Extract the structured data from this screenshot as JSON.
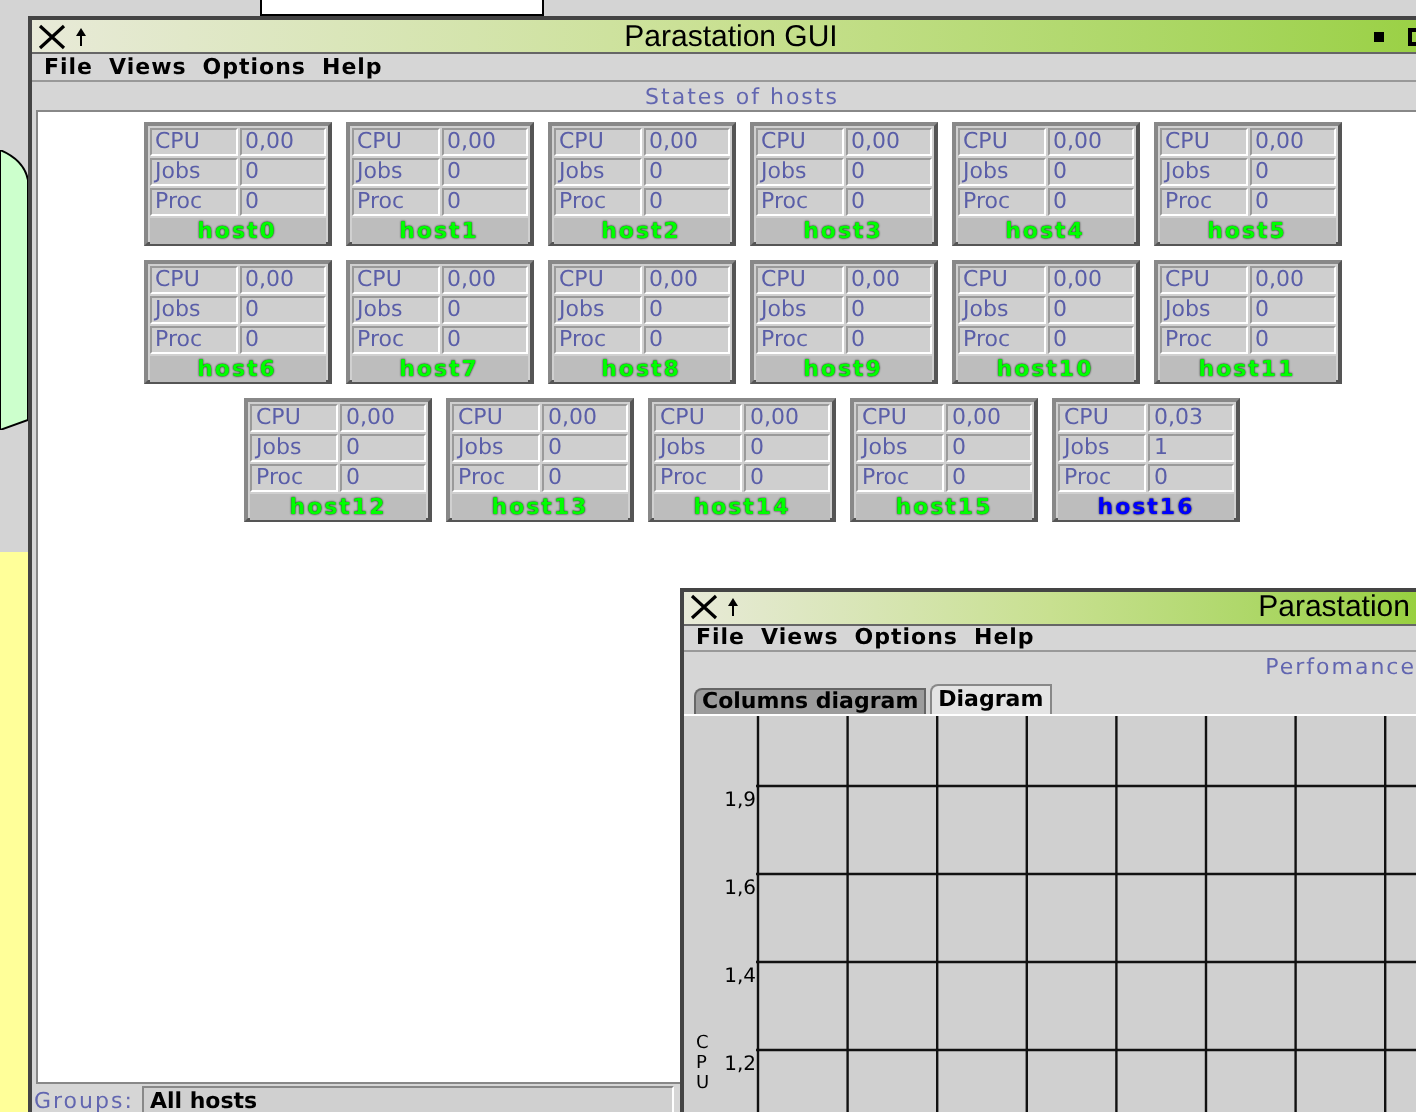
{
  "main_window": {
    "title": "Parastation GUI",
    "menu": [
      "File",
      "Views",
      "Options",
      "Help"
    ],
    "panel_title": "States of hosts",
    "hosts": [
      {
        "name": "host0",
        "color": "#00ff00",
        "rows": [
          {
            "label": "CPU",
            "value": "0,00"
          },
          {
            "label": "Jobs",
            "value": "0"
          },
          {
            "label": "Proc",
            "value": "0"
          }
        ]
      },
      {
        "name": "host1",
        "color": "#00ff00",
        "rows": [
          {
            "label": "CPU",
            "value": "0,00"
          },
          {
            "label": "Jobs",
            "value": "0"
          },
          {
            "label": "Proc",
            "value": "0"
          }
        ]
      },
      {
        "name": "host2",
        "color": "#00ff00",
        "rows": [
          {
            "label": "CPU",
            "value": "0,00"
          },
          {
            "label": "Jobs",
            "value": "0"
          },
          {
            "label": "Proc",
            "value": "0"
          }
        ]
      },
      {
        "name": "host3",
        "color": "#00ff00",
        "rows": [
          {
            "label": "CPU",
            "value": "0,00"
          },
          {
            "label": "Jobs",
            "value": "0"
          },
          {
            "label": "Proc",
            "value": "0"
          }
        ]
      },
      {
        "name": "host4",
        "color": "#00ff00",
        "rows": [
          {
            "label": "CPU",
            "value": "0,00"
          },
          {
            "label": "Jobs",
            "value": "0"
          },
          {
            "label": "Proc",
            "value": "0"
          }
        ]
      },
      {
        "name": "host5",
        "color": "#00ff00",
        "rows": [
          {
            "label": "CPU",
            "value": "0,00"
          },
          {
            "label": "Jobs",
            "value": "0"
          },
          {
            "label": "Proc",
            "value": "0"
          }
        ]
      },
      {
        "name": "host6",
        "color": "#00ff00",
        "rows": [
          {
            "label": "CPU",
            "value": "0,00"
          },
          {
            "label": "Jobs",
            "value": "0"
          },
          {
            "label": "Proc",
            "value": "0"
          }
        ]
      },
      {
        "name": "host7",
        "color": "#00ff00",
        "rows": [
          {
            "label": "CPU",
            "value": "0,00"
          },
          {
            "label": "Jobs",
            "value": "0"
          },
          {
            "label": "Proc",
            "value": "0"
          }
        ]
      },
      {
        "name": "host8",
        "color": "#00ff00",
        "rows": [
          {
            "label": "CPU",
            "value": "0,00"
          },
          {
            "label": "Jobs",
            "value": "0"
          },
          {
            "label": "Proc",
            "value": "0"
          }
        ]
      },
      {
        "name": "host9",
        "color": "#00ff00",
        "rows": [
          {
            "label": "CPU",
            "value": "0,00"
          },
          {
            "label": "Jobs",
            "value": "0"
          },
          {
            "label": "Proc",
            "value": "0"
          }
        ]
      },
      {
        "name": "host10",
        "color": "#00ff00",
        "rows": [
          {
            "label": "CPU",
            "value": "0,00"
          },
          {
            "label": "Jobs",
            "value": "0"
          },
          {
            "label": "Proc",
            "value": "0"
          }
        ]
      },
      {
        "name": "host11",
        "color": "#00ff00",
        "rows": [
          {
            "label": "CPU",
            "value": "0,00"
          },
          {
            "label": "Jobs",
            "value": "0"
          },
          {
            "label": "Proc",
            "value": "0"
          }
        ]
      },
      {
        "name": "host12",
        "color": "#00ff00",
        "rows": [
          {
            "label": "CPU",
            "value": "0,00"
          },
          {
            "label": "Jobs",
            "value": "0"
          },
          {
            "label": "Proc",
            "value": "0"
          }
        ]
      },
      {
        "name": "host13",
        "color": "#00ff00",
        "rows": [
          {
            "label": "CPU",
            "value": "0,00"
          },
          {
            "label": "Jobs",
            "value": "0"
          },
          {
            "label": "Proc",
            "value": "0"
          }
        ]
      },
      {
        "name": "host14",
        "color": "#00ff00",
        "rows": [
          {
            "label": "CPU",
            "value": "0,00"
          },
          {
            "label": "Jobs",
            "value": "0"
          },
          {
            "label": "Proc",
            "value": "0"
          }
        ]
      },
      {
        "name": "host15",
        "color": "#00ff00",
        "rows": [
          {
            "label": "CPU",
            "value": "0,00"
          },
          {
            "label": "Jobs",
            "value": "0"
          },
          {
            "label": "Proc",
            "value": "0"
          }
        ]
      },
      {
        "name": "host16",
        "color": "#0000ff",
        "rows": [
          {
            "label": "CPU",
            "value": "0,03"
          },
          {
            "label": "Jobs",
            "value": "1"
          },
          {
            "label": "Proc",
            "value": "0"
          }
        ]
      }
    ],
    "groups_label": "Groups:",
    "groups_value": "All hosts"
  },
  "performance_window": {
    "title": "Parastation",
    "menu": [
      "File",
      "Views",
      "Options",
      "Help"
    ],
    "panel_title": "Perfomance",
    "tabs": [
      {
        "label": "Columns diagram",
        "selected": false
      },
      {
        "label": "Diagram",
        "selected": true
      }
    ],
    "y_axis_label": "CPU",
    "y_ticks": [
      "1,9",
      "1,6",
      "1,4",
      "1,2"
    ]
  }
}
